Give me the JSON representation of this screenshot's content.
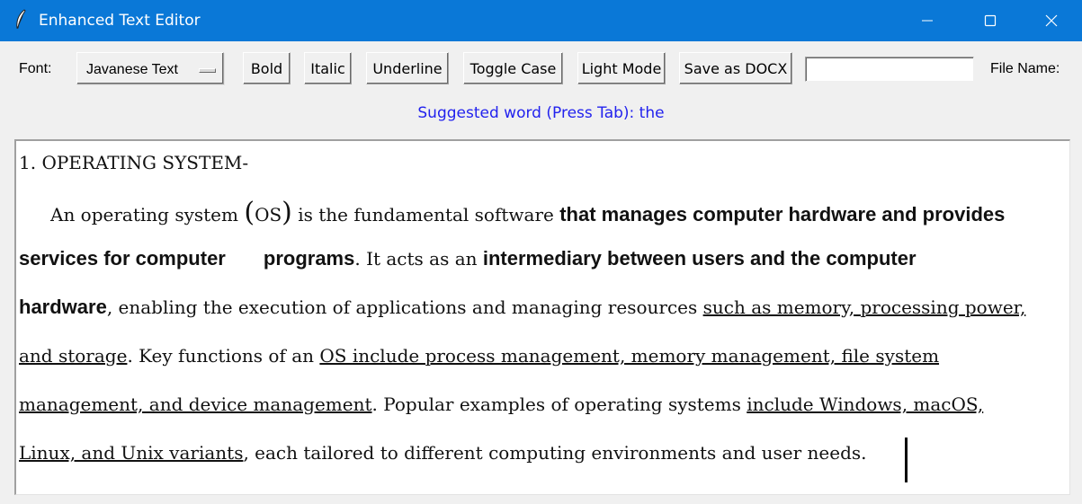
{
  "window": {
    "title": "Enhanced Text Editor",
    "icons": {
      "app": "feather-icon",
      "minimize": "minimize-icon",
      "maximize": "maximize-icon",
      "close": "close-icon"
    }
  },
  "toolbar": {
    "font_label": "Font:",
    "font_value": "Javanese Text",
    "bold": "Bold",
    "italic": "Italic",
    "underline": "Underline",
    "toggle_case": "Toggle Case",
    "light_mode": "Light Mode",
    "save_docx": "Save as DOCX",
    "file_name_value": "",
    "file_name_label": "File Name:"
  },
  "suggestion": "Suggested word (Press Tab): the",
  "document": {
    "l1": "1. OPERATING SYSTEM-",
    "l2a": "An operating system ",
    "l2p1": "(",
    "l2os": "OS",
    "l2p2": ")",
    "l2b": " is the fundamental software ",
    "l2c": "that manages computer hardware and provides",
    "l3a": "services for computer",
    "l3b": "programs",
    "l3c": ". It acts as an ",
    "l3d": "intermediary between users and the computer",
    "l4a": "hardware",
    "l4b": ", enabling the execution of applications and managing   resources ",
    "l4c": "such as memory, processing power,",
    "l5a": "and storage",
    "l5b": ". Key functions of an ",
    "l5c": "OS include process management, memory management, file  system ",
    "l6a": "management, and device management",
    "l6b": ". Popular examples of operating systems ",
    "l6c": "include Windows, macOS, ",
    "l7a": "Linux, and Unix variants",
    "l7b": ",  each tailored to different computing environments and user needs."
  },
  "colors": {
    "titlebar": "#0a78d7",
    "suggestion": "#2222ee",
    "background": "#f0f0f0"
  }
}
